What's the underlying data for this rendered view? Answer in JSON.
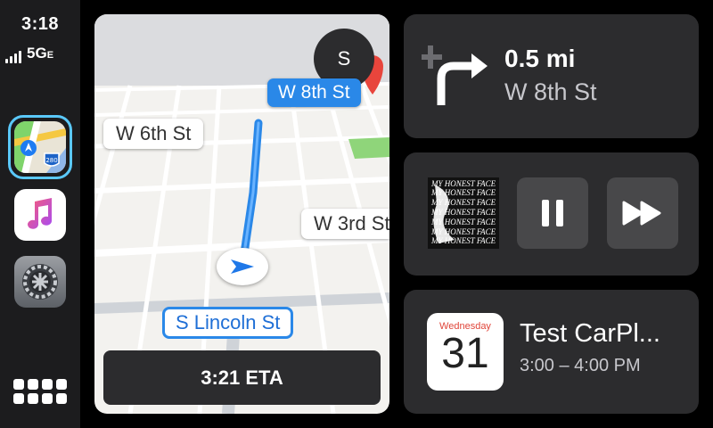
{
  "status": {
    "time": "3:18",
    "network": "5G",
    "network_suffix": "E"
  },
  "sidebar": {
    "apps": [
      {
        "name": "Maps",
        "icon": "maps-icon",
        "badge": "280"
      },
      {
        "name": "Music",
        "icon": "music-icon"
      },
      {
        "name": "Settings",
        "icon": "settings-icon"
      }
    ],
    "home_icon": "app-grid-icon"
  },
  "map": {
    "avatar_initial": "S",
    "streets": {
      "w6": "W 6th St",
      "w3": "W 3rd St",
      "w8": "W 8th St"
    },
    "current_street": "S Lincoln St",
    "eta": "3:21 ETA",
    "route_color": "#2a88e8"
  },
  "navigation": {
    "distance": "0.5 mi",
    "street": "W 8th St",
    "maneuver_icon": "turn-right-icon"
  },
  "media": {
    "album_lines": [
      "MY HONEST FACE",
      "MY HONEST FACE",
      "MY HONEST FACE",
      "MY HONEST FACE",
      "MY HONEST FACE",
      "MY HONEST FACE",
      "MY HONEST FACE"
    ],
    "controls": [
      "pause-icon",
      "fast-forward-icon"
    ]
  },
  "calendar": {
    "weekday": "Wednesday",
    "date": "31",
    "event_title": "Test CarPl...",
    "event_time": "3:00 – 4:00 PM"
  }
}
